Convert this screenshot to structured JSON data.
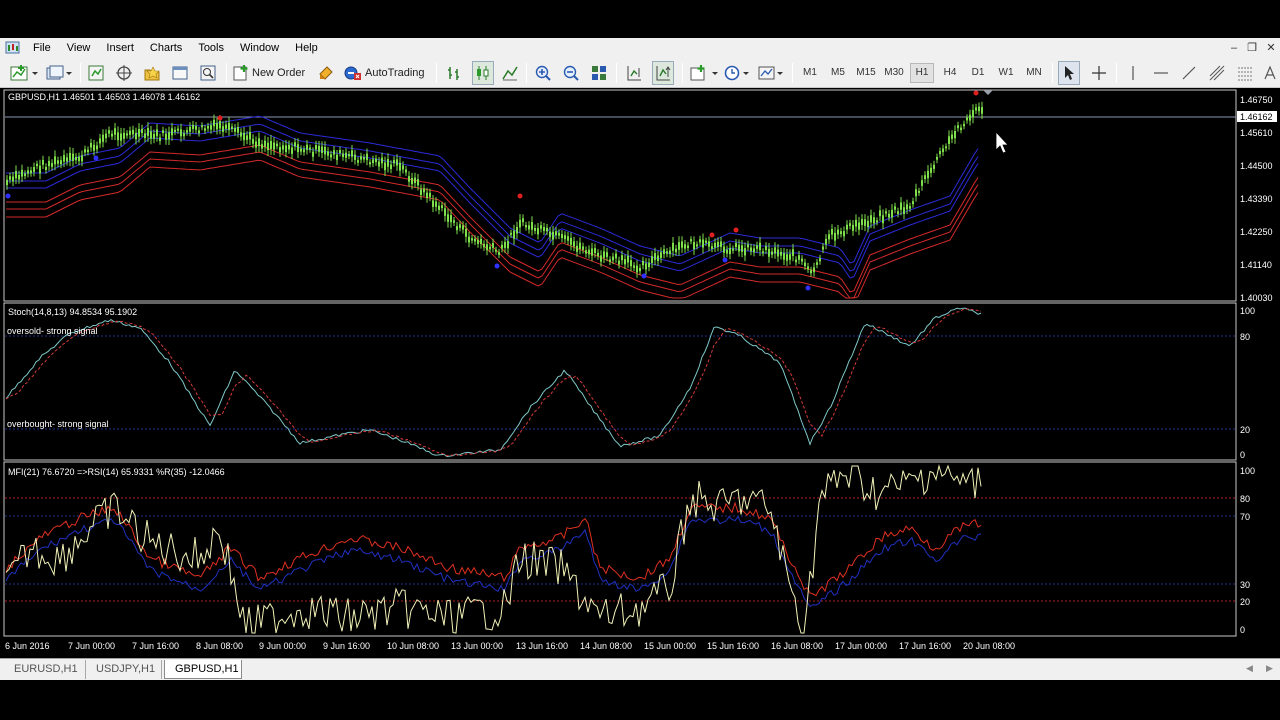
{
  "menu": {
    "items": [
      "File",
      "View",
      "Insert",
      "Charts",
      "Tools",
      "Window",
      "Help"
    ]
  },
  "toolbar": {
    "new_order_label": "New Order",
    "autotrading_label": "AutoTrading",
    "timeframes": [
      "M1",
      "M5",
      "M15",
      "M30",
      "H1",
      "H4",
      "D1",
      "W1",
      "MN"
    ],
    "active_timeframe": "H1"
  },
  "main_chart": {
    "header": "GBPUSD,H1  1.46501 1.46503 1.46078 1.46162",
    "price_ticks": [
      "1.46750",
      "1.45610",
      "1.44500",
      "1.43390",
      "1.42250",
      "1.41140",
      "1.40030"
    ],
    "current_price": "1.46162"
  },
  "stoch_panel": {
    "header": "Stoch(14,8,13) 94.8534 95.1902",
    "label_top": "oversold-  strong signal",
    "label_bottom": "overbought- strong signal",
    "levels": [
      "100",
      "80",
      "20",
      "0"
    ]
  },
  "mfi_panel": {
    "header": "MFI(21) 76.6720  =>RSI(14) 65.9331  %R(35) -12.0466",
    "levels": [
      "100",
      "80",
      "70",
      "30",
      "20",
      "0"
    ]
  },
  "time_axis": [
    "6 Jun 2016",
    "7 Jun 00:00",
    "7 Jun 16:00",
    "8 Jun 08:00",
    "9 Jun 00:00",
    "9 Jun 16:00",
    "10 Jun 08:00",
    "13 Jun 00:00",
    "13 Jun 16:00",
    "14 Jun 08:00",
    "15 Jun 00:00",
    "15 Jun 16:00",
    "16 Jun 08:00",
    "17 Jun 00:00",
    "17 Jun 16:00",
    "20 Jun 08:00"
  ],
  "tabs": [
    "EURUSD,H1",
    "USDJPY,H1",
    "GBPUSD,H1"
  ],
  "active_tab": "GBPUSD,H1",
  "colors": {
    "candle": "#7ee04a",
    "band_blue": "#2b2bd8",
    "band_red": "#d42a2a",
    "stoch_main": "#7fc8c8",
    "stoch_signal": "#d43a3a",
    "mfi": "#f2f2b8",
    "rsi": "#e03020",
    "wpr": "#2030c0"
  }
}
